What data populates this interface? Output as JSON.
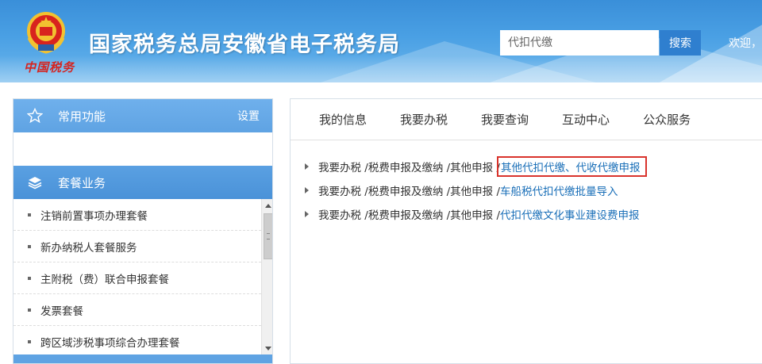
{
  "header": {
    "site_title": "国家税务总局安徽省电子税务局",
    "slogan": "中国税务",
    "search_placeholder": "代扣代缴",
    "search_button": "搜索",
    "welcome": "欢迎，"
  },
  "left_panel": {
    "common_title": "常用功能",
    "settings_label": "设置",
    "package_title": "套餐业务",
    "packages": [
      "注销前置事项办理套餐",
      "新办纳税人套餐服务",
      "主附税（费）联合申报套餐",
      "发票套餐",
      "跨区域涉税事项综合办理套餐"
    ]
  },
  "tabs": [
    "我的信息",
    "我要办税",
    "我要查询",
    "互动中心",
    "公众服务"
  ],
  "results": [
    {
      "path": "我要办税 /税费申报及缴纳 /其他申报 /",
      "link": "其他代扣代缴、代收代缴申报"
    },
    {
      "path": "我要办税 /税费申报及缴纳 /其他申报 /",
      "link": "车船税代扣代缴批量导入"
    },
    {
      "path": "我要办税 /税费申报及缴纳 /其他申报 /",
      "link": "代扣代缴文化事业建设费申报"
    }
  ],
  "colors": {
    "header_blue": "#3a8fd9",
    "link_blue": "#1a6fb8",
    "highlight_red": "#d9332c"
  }
}
